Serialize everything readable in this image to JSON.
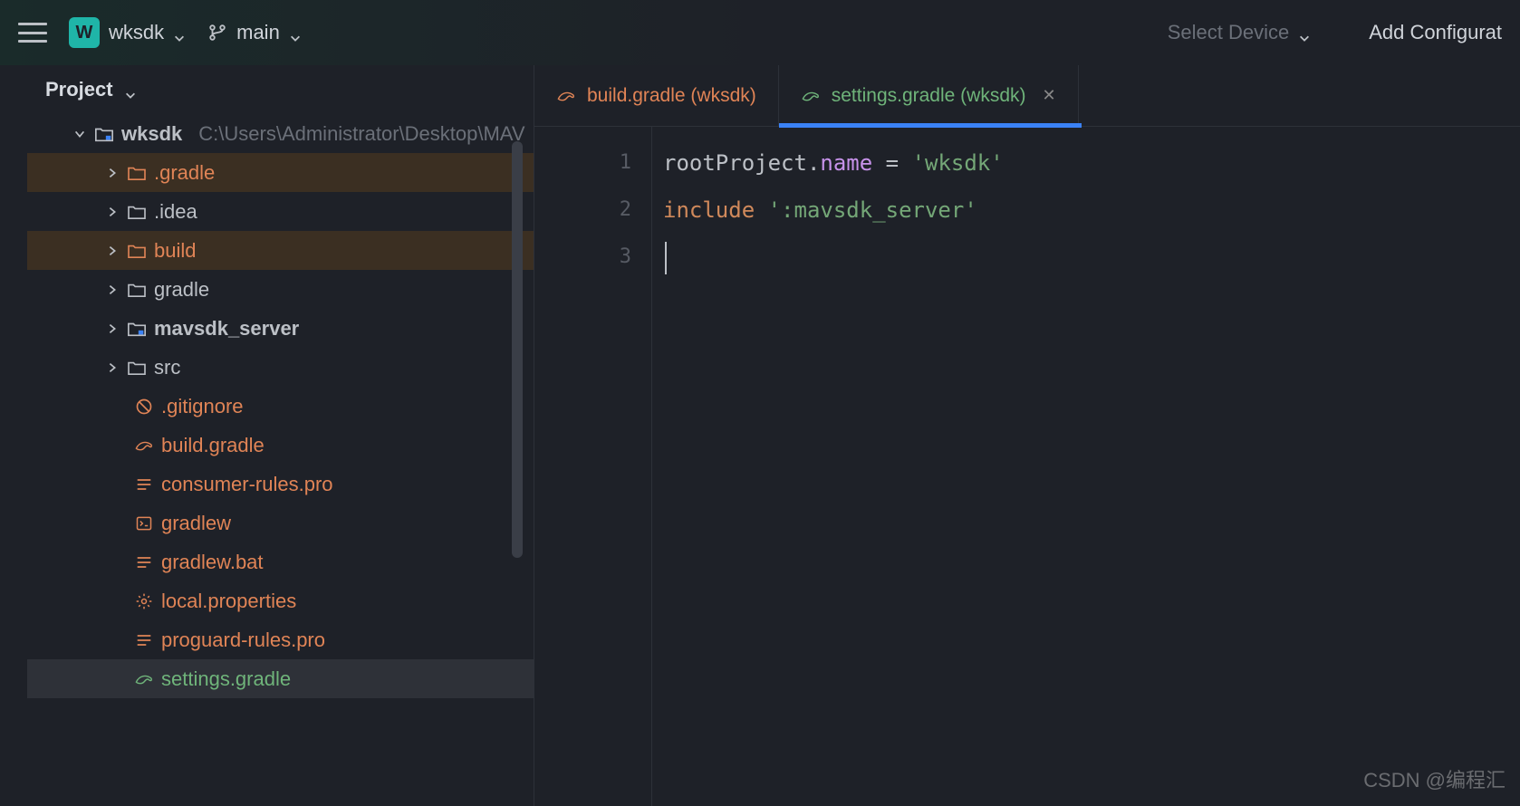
{
  "toolbar": {
    "project_initial": "W",
    "project_name": "wksdk",
    "branch": "main",
    "device_selector": "Select Device",
    "add_config": "Add Configurat"
  },
  "sidebar": {
    "header": "Project",
    "root": {
      "name": "wksdk",
      "path": "C:\\Users\\Administrator\\Desktop\\MAV"
    },
    "items": [
      {
        "label": ".gradle",
        "type": "folder",
        "color": "orange",
        "highlight": true,
        "chev": true
      },
      {
        "label": ".idea",
        "type": "folder",
        "color": "grey",
        "highlight": false,
        "chev": true
      },
      {
        "label": "build",
        "type": "folder",
        "color": "orange",
        "highlight": true,
        "chev": true
      },
      {
        "label": "gradle",
        "type": "folder",
        "color": "grey",
        "highlight": false,
        "chev": true
      },
      {
        "label": "mavsdk_server",
        "type": "module",
        "color": "grey",
        "highlight": false,
        "chev": true,
        "bold": true
      },
      {
        "label": "src",
        "type": "folder",
        "color": "grey",
        "highlight": false,
        "chev": true
      },
      {
        "label": ".gitignore",
        "type": "file",
        "icon": "ban",
        "color": "orange"
      },
      {
        "label": "build.gradle",
        "type": "file",
        "icon": "gradle",
        "color": "orange"
      },
      {
        "label": "consumer-rules.pro",
        "type": "file",
        "icon": "lines",
        "color": "orange"
      },
      {
        "label": "gradlew",
        "type": "file",
        "icon": "terminal",
        "color": "orange"
      },
      {
        "label": "gradlew.bat",
        "type": "file",
        "icon": "lines",
        "color": "orange"
      },
      {
        "label": "local.properties",
        "type": "file",
        "icon": "gear",
        "color": "orange"
      },
      {
        "label": "proguard-rules.pro",
        "type": "file",
        "icon": "lines",
        "color": "orange"
      },
      {
        "label": "settings.gradle",
        "type": "file",
        "icon": "gradle",
        "color": "green",
        "selected": true
      }
    ]
  },
  "tabs": [
    {
      "label": "build.gradle (wksdk)",
      "color": "orange",
      "active": false
    },
    {
      "label": "settings.gradle (wksdk)",
      "color": "green",
      "active": true
    }
  ],
  "editor": {
    "lines": [
      "1",
      "2",
      "3"
    ],
    "code": {
      "l1_p1": "rootProject",
      "l1_p2": ".",
      "l1_p3": "name",
      "l1_p4": " = ",
      "l1_p5": "'wksdk'",
      "l2_p1": "include ",
      "l2_p2": "':mavsdk_server'"
    }
  },
  "watermark": "CSDN @编程汇"
}
